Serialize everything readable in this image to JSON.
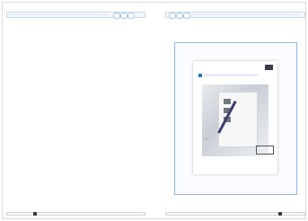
{
  "left_panel": {
    "toolbar": {
      "buttons": [
        "pill-button",
        "pill-button",
        "arrow-button"
      ]
    },
    "scrollbar": {
      "position": 0.2
    }
  },
  "right_panel": {
    "toolbar": {
      "buttons": [
        "arrow-button",
        "pill-button",
        "pill-button"
      ]
    },
    "document_preview": {
      "thumbnail": "document-page-with-pen-icon"
    },
    "scrollbar": {
      "position": 0.8
    }
  }
}
